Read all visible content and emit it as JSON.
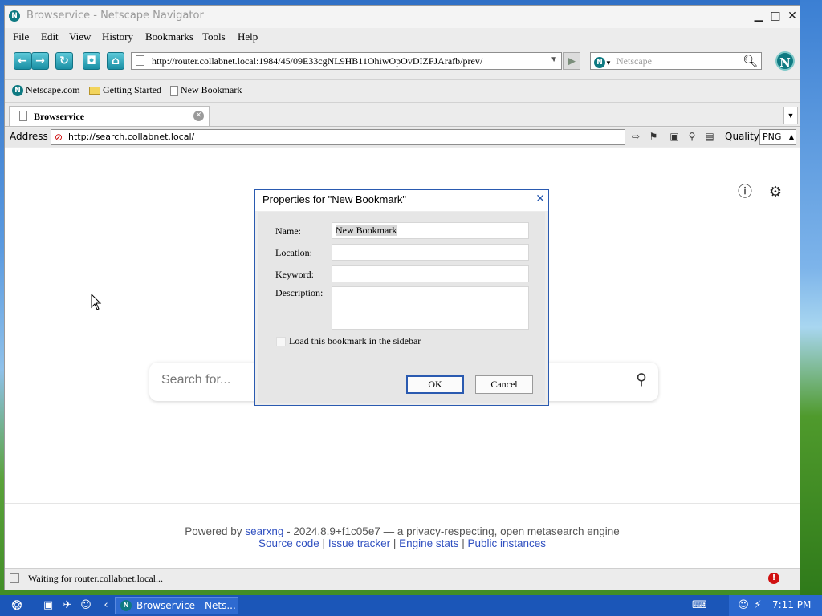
{
  "window": {
    "title": "Browservice - Netscape Navigator",
    "minimize": "▁",
    "maximize": "□",
    "close": "✕"
  },
  "menu": [
    "File",
    "Edit",
    "View",
    "History",
    "Bookmarks",
    "Tools",
    "Help"
  ],
  "nav": {
    "url": "http://router.collabnet.local:1984/45/09E33cgNL9HB11OhiwOpOvDIZFJArafb/prev/",
    "search_placeholder": "Netscape",
    "icons": [
      "back-icon",
      "forward-icon",
      "reload-icon",
      "stop-icon",
      "home-icon",
      "go-icon",
      "search-icon",
      "netscape-logo"
    ]
  },
  "bookmarks": [
    "Netscape.com",
    "Getting Started",
    "New Bookmark"
  ],
  "tab": {
    "label": "Browservice"
  },
  "address": {
    "label": "Address",
    "url": "http://search.collabnet.local/",
    "quality_label": "Quality",
    "quality_value": "PNG"
  },
  "content": {
    "search_placeholder": "Search for...",
    "footer_powered_prefix": "Powered by",
    "footer_powered_link": "searxng",
    "footer_powered_suffix": "- 2024.8.9+f1c05e7 — a privacy-respecting, open metasearch engine",
    "footer_links": [
      "Source code",
      "Issue tracker",
      "Engine stats",
      "Public instances"
    ],
    "separator": "|"
  },
  "status": {
    "text": "Waiting for router.collabnet.local..."
  },
  "dialog": {
    "title": "Properties for \"New Bookmark\"",
    "name_label": "Name:",
    "name_value": "New Bookmark",
    "location_label": "Location:",
    "location_value": "",
    "keyword_label": "Keyword:",
    "keyword_value": "",
    "description_label": "Description:",
    "description_value": "",
    "sidebar_checkbox_label": "Load this bookmark in the sidebar",
    "ok": "OK",
    "cancel": "Cancel"
  },
  "taskbar": {
    "task_label": "Browservice - Nets...",
    "clock": "7:11 PM"
  }
}
